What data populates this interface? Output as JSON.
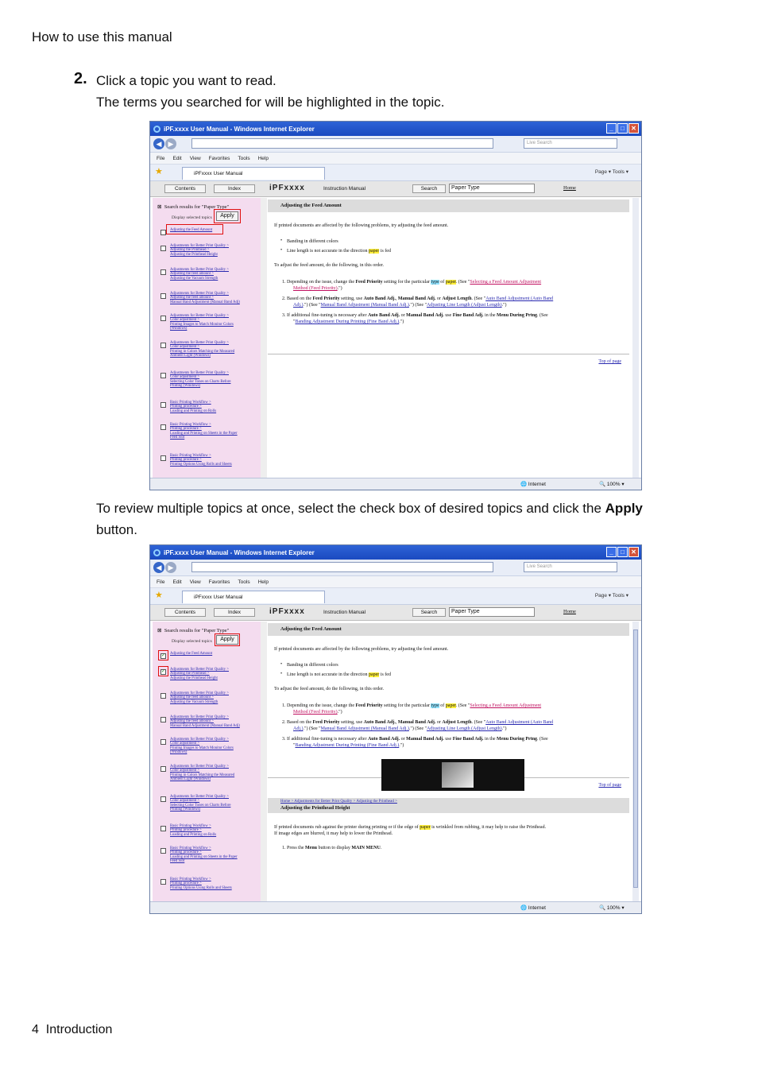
{
  "header": {
    "title": "How to use this manual"
  },
  "step": {
    "number": "2.",
    "line1": "Click a topic you want to read.",
    "line2": "The terms you searched for will be highlighted in the topic."
  },
  "paragraph": {
    "text_before": "To review multiple topics at once, select the check box of desired topics and click the ",
    "bold": "Apply",
    "text_after": " button."
  },
  "footer": {
    "page": "4",
    "section": "Introduction"
  },
  "browser": {
    "title": "iPF.xxxx User Manual - Windows Internet Explorer",
    "live_search": "Live Search",
    "menu": [
      "File",
      "Edit",
      "View",
      "Favorites",
      "Tools",
      "Help"
    ],
    "tab": "iPFxxxx User Manual",
    "tools_right": "Page ▾  Tools ▾",
    "manual_bar": {
      "contents": "Contents",
      "index": "Index",
      "brand": "iPFxxxx",
      "instruction": "Instruction Manual",
      "search_btn": "Search",
      "search_value": "Paper Type",
      "home": "Home"
    },
    "sidebar": {
      "title": "Search results for \"Paper Type\"",
      "display_selected": "Display selected topics",
      "apply": "Apply",
      "items": [
        [
          "Adjusting the Feed Amount"
        ],
        [
          "Adjustments for Better Print Quality >",
          "Adjusting the Printhead >",
          "Adjusting the Printhead Height"
        ],
        [
          "Adjustments for Better Print Quality >",
          "Adjusting the feed amount >",
          "Adjusting the Vacuum Strength"
        ],
        [
          "Adjustments for Better Print Quality >",
          "Adjusting the feed amount >",
          "Manual Band Adjustment (Manual Band Adj)"
        ],
        [
          "Adjustments for Better Print Quality >",
          "Color adjustment >",
          "Printing Images to Match Monitor Colors",
          "(Windows)"
        ],
        [
          "Adjustments for Better Print Quality >",
          "Color adjustment >",
          "Printing in Colors Matching the Measured",
          "Ambient Light (Windows)"
        ],
        [
          "Adjustments for Better Print Quality >",
          "Color adjustment >",
          "Selecting Color Tones on Charts Before",
          "Printing (Windows)"
        ],
        [
          "Basic Printing Workflow >",
          "Printing procedure >",
          "Loading and Printing on Rolls"
        ],
        [
          "Basic Printing Workflow >",
          "Printing procedure >",
          "Loading and Printing on Sheets in the Paper",
          "Feed Slot"
        ],
        [
          "Basic Printing Workflow >",
          "Printing procedure >",
          "Printing Options Using Rolls and Sheets"
        ]
      ]
    },
    "main": {
      "heading": "Adjusting the Feed Amount",
      "intro": "If printed documents are affected by the following problems, try adjusting the feed amount.",
      "bullet1": "Banding in different colors",
      "bullet2_before": "Line length is not accurate in the direction ",
      "bullet2_hl": "paper",
      "bullet2_after": " is fed",
      "to_adjust": "To adjust the feed amount, do the following, in this order.",
      "s1_a": "1.  Depending on the issue, change the ",
      "s1_b": "Feed Priority",
      "s1_c": " setting for the particular ",
      "s1_d": "type",
      "s1_e": " of ",
      "s1_f": "paper",
      "s1_g": ". (See \"",
      "s1_h": "Selecting a Feed Amount Adjustment",
      "s1_i": "Method (Feed Priority)",
      "s1_j": ".\")",
      "s2_a": "2.  Based on the ",
      "s2_b": "Feed Priority",
      "s2_c": " setting, use ",
      "s2_d": "Auto Band Adj.",
      "s2_e": ", ",
      "s2_f": "Manual Band Adj.",
      "s2_g": " or ",
      "s2_h": "Adjust Length",
      "s2_i": ".  (See \"",
      "s2_j": "Auto Band Adjustment (Auto Band",
      "s2_k": "Adj.)",
      "s2_l": ".\") (See \"",
      "s2_m": "Manual Band Adjustment (Manual Band Adj.)",
      "s2_n": ".\") (See \"",
      "s2_o": "Adjusting Line Length (Adjust Length)",
      "s2_p": ".\")",
      "s3_a": "3.  If additional fine-tuning is necessary after ",
      "s3_b": "Auto Band Adj.",
      "s3_c": " or ",
      "s3_d": "Manual Band Adj.",
      "s3_e": " use ",
      "s3_f": "Fine Band Adj.",
      "s3_g": " in the ",
      "s3_h": "Menu During Prtng",
      "s3_i": ".  (See",
      "s3_j": "\"",
      "s3_k": "Banding Adjustment During Printing (Fine Band Adj.)",
      "s3_l": ".\")",
      "top": "Top of page",
      "crumb": "Home > Adjustments for Better Print Quality > Adjusting the Printhead >",
      "heading2": "Adjusting the Printhead Height",
      "p2_a": "If printed documents rub against the printer during printing or if the edge of ",
      "p2_hl": "paper",
      "p2_b": " is wrinkled from rubbing, it may help to raise the Printhead.",
      "p2_c": "If image edges are blurred, it may help to lower the Printhead.",
      "p2_step": "1.  Press the ",
      "p2_menu": "Menu",
      "p2_step2": " button to display ",
      "p2_main": "MAIN MENU",
      "p2_end": "."
    },
    "status": {
      "zone": "Internet",
      "zoom": "100%"
    }
  }
}
